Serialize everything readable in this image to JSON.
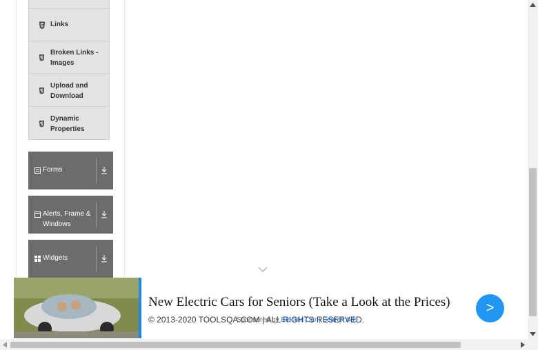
{
  "sidebar": {
    "sub_items": [
      {
        "label": "Links",
        "icon": "html5-icon"
      },
      {
        "label": "Broken Links - Images",
        "icon": "html5-icon"
      },
      {
        "label": "Upload and Download",
        "icon": "html5-icon"
      },
      {
        "label": "Dynamic Properties",
        "icon": "html5-icon"
      }
    ],
    "groups": [
      {
        "label": "Forms",
        "icon": "form-icon"
      },
      {
        "label": "Alerts, Frame & Windows",
        "icon": "window-icon"
      },
      {
        "label": "Widgets",
        "icon": "widgets-icon"
      }
    ]
  },
  "footer": {
    "copyright": "© 2013-2020 TOOLSQA.COM | ALL RIGHTS RESERVED.",
    "sponsored": "Sponsored by",
    "sponsor_link": "Electric Car | Search Ads"
  },
  "ad": {
    "title": "New Electric Cars for Seniors (Take a Look at the Prices)",
    "button": ">"
  },
  "colors": {
    "accent": "#2196f3",
    "group_bg": "#6c6c6c",
    "sub_bg": "#e3e3e3"
  }
}
